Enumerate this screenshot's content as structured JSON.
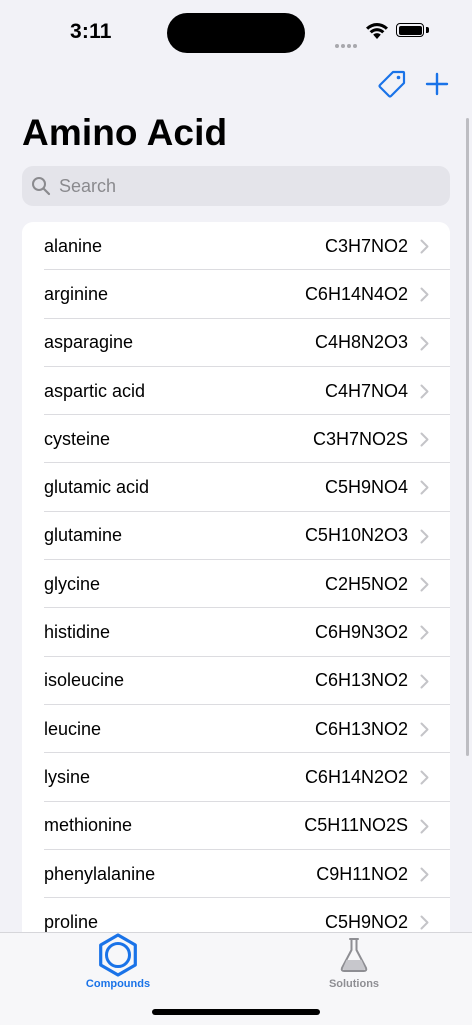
{
  "status_bar": {
    "time": "3:11"
  },
  "header": {
    "title": "Amino Acid"
  },
  "search": {
    "placeholder": "Search"
  },
  "compounds": [
    {
      "name": "alanine",
      "formula": "C3H7NO2"
    },
    {
      "name": "arginine",
      "formula": "C6H14N4O2"
    },
    {
      "name": "asparagine",
      "formula": "C4H8N2O3"
    },
    {
      "name": "aspartic acid",
      "formula": "C4H7NO4"
    },
    {
      "name": "cysteine",
      "formula": "C3H7NO2S"
    },
    {
      "name": "glutamic acid",
      "formula": "C5H9NO4"
    },
    {
      "name": "glutamine",
      "formula": "C5H10N2O3"
    },
    {
      "name": "glycine",
      "formula": "C2H5NO2"
    },
    {
      "name": "histidine",
      "formula": "C6H9N3O2"
    },
    {
      "name": "isoleucine",
      "formula": "C6H13NO2"
    },
    {
      "name": "leucine",
      "formula": "C6H13NO2"
    },
    {
      "name": "lysine",
      "formula": "C6H14N2O2"
    },
    {
      "name": "methionine",
      "formula": "C5H11NO2S"
    },
    {
      "name": "phenylalanine",
      "formula": "C9H11NO2"
    },
    {
      "name": "proline",
      "formula": "C5H9NO2"
    }
  ],
  "tab_bar": {
    "compounds_label": "Compounds",
    "solutions_label": "Solutions",
    "active": "compounds"
  },
  "icons": {
    "tag": "tag-icon",
    "add": "plus-icon",
    "search": "magnifying-glass-icon",
    "chevron": "chevron-right-icon",
    "compounds": "hexagon-benzene-icon",
    "solutions": "flask-icon"
  },
  "colors": {
    "accent": "#1a73e8",
    "inactive_tab": "#8e8e93",
    "background": "#f2f2f7"
  }
}
